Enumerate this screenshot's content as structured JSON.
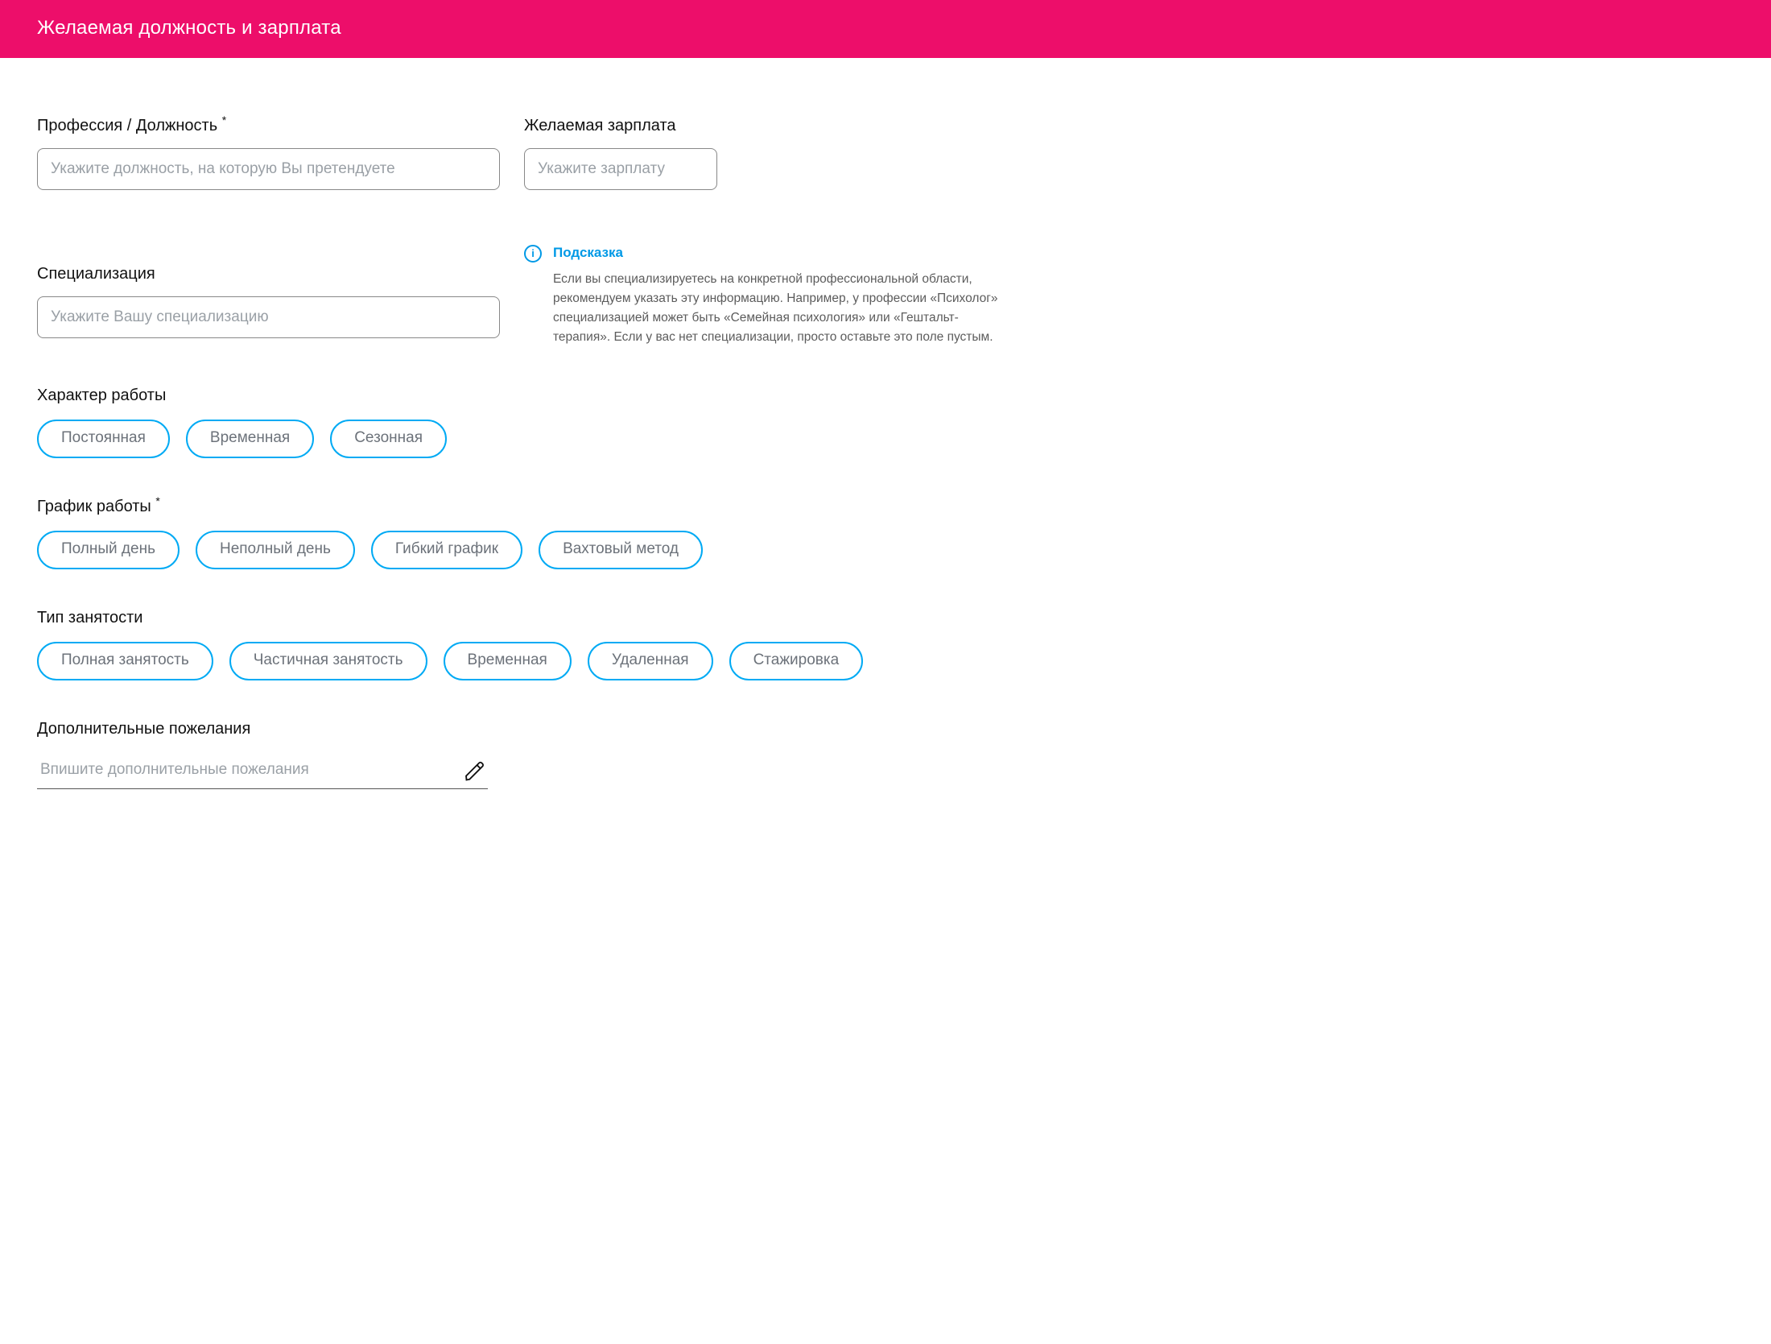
{
  "colors": {
    "accent_pink": "#ed0e6a",
    "accent_blue": "#00aaf4",
    "hint_blue": "#0099e6"
  },
  "header": {
    "title": "Желаемая должность и зарплата"
  },
  "profession": {
    "label": "Профессия / Должность",
    "required_marker": "*",
    "placeholder": "Укажите должность, на которую Вы претендуете",
    "value": ""
  },
  "salary": {
    "label": "Желаемая зарплата",
    "placeholder": "Укажите зарплату",
    "value": ""
  },
  "specialization": {
    "label": "Специализация",
    "placeholder": "Укажите Вашу специализацию",
    "value": ""
  },
  "hint": {
    "icon_glyph": "i",
    "title": "Подсказка",
    "text": "Если вы специализируетесь на конкретной профессиональной области, рекомендуем указать эту информацию. Например, у профессии «Психолог» специализацией может быть «Семейная психология» или «Гештальт-терапия». Если у вас нет специализации, просто оставьте это поле пустым."
  },
  "work_nature": {
    "label": "Характер работы",
    "options": [
      "Постоянная",
      "Временная",
      "Сезонная"
    ]
  },
  "schedule": {
    "label": "График работы",
    "required_marker": "*",
    "options": [
      "Полный день",
      "Неполный день",
      "Гибкий график",
      "Вахтовый метод"
    ]
  },
  "employment": {
    "label": "Тип занятости",
    "options": [
      "Полная занятость",
      "Частичная занятость",
      "Временная",
      "Удаленная",
      "Стажировка"
    ]
  },
  "wishes": {
    "label": "Дополнительные пожелания",
    "placeholder": "Впишите дополнительные пожелания",
    "value": ""
  }
}
